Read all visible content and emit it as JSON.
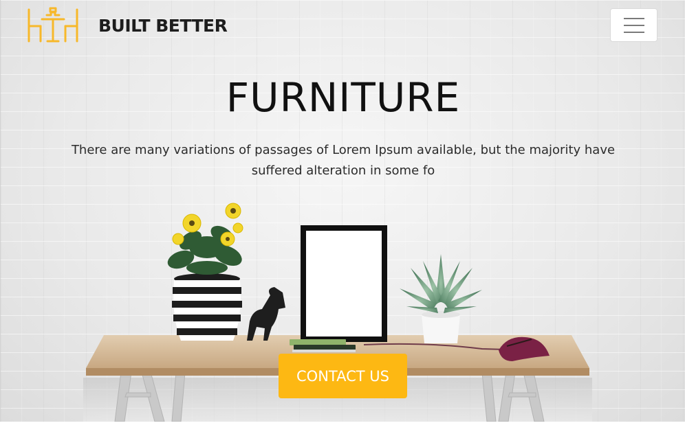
{
  "header": {
    "brand_name": "BUILT BETTER",
    "logo_icon": "table-chairs-logo-icon",
    "menu_icon": "hamburger-icon"
  },
  "hero": {
    "title": "FURNITURE",
    "description": "There are many variations of passages of Lorem Ipsum available, but the majority have suffered alteration in some fo",
    "cta_label": "CONTACT US"
  },
  "colors": {
    "accent": "#fdb813",
    "text_dark": "#111111",
    "background": "#ececec"
  }
}
